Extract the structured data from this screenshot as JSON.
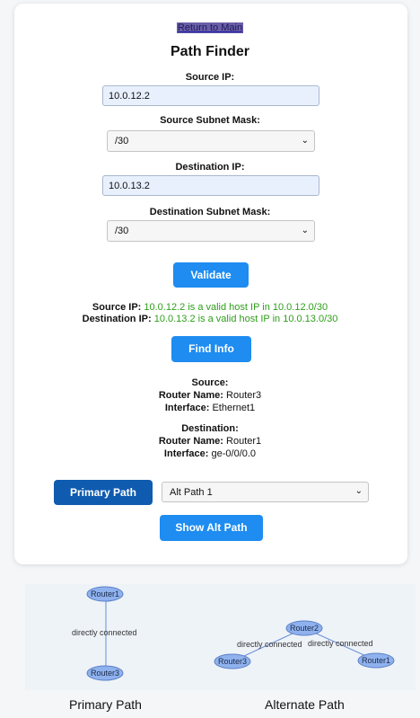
{
  "header": {
    "return_link": "Return to Main",
    "title": "Path Finder"
  },
  "form": {
    "source_ip_label": "Source IP:",
    "source_ip_value": "10.0.12.2",
    "source_mask_label": "Source Subnet Mask:",
    "source_mask_value": "/30",
    "dest_ip_label": "Destination IP:",
    "dest_ip_value": "10.0.13.2",
    "dest_mask_label": "Destination Subnet Mask:",
    "dest_mask_value": "/30",
    "validate_label": "Validate"
  },
  "validation": {
    "source_key": "Source IP:",
    "source_msg": "10.0.12.2 is a valid host IP in 10.0.12.0/30",
    "dest_key": "Destination IP:",
    "dest_msg": "10.0.13.2 is a valid host IP in 10.0.13.0/30",
    "ok_color": "#2e9e1a"
  },
  "find_info_label": "Find Info",
  "source_info": {
    "heading": "Source:",
    "router_key": "Router Name:",
    "router_val": "Router3",
    "iface_key": "Interface:",
    "iface_val": "Ethernet1"
  },
  "dest_info": {
    "heading": "Destination:",
    "router_key": "Router Name:",
    "router_val": "Router1",
    "iface_key": "Interface:",
    "iface_val": "ge-0/0/0.0"
  },
  "paths": {
    "primary_label": "Primary Path",
    "alt_select_value": "Alt Path 1",
    "show_alt_label": "Show Alt Path"
  },
  "graphs": {
    "primary": {
      "nodes": [
        "Router1",
        "Router3"
      ],
      "edge_label": "directly connected",
      "caption": "Primary Path"
    },
    "alternate": {
      "nodes": [
        "Router2",
        "Router3",
        "Router1"
      ],
      "edge_label_left": "directly connected",
      "edge_label_right": "directly connected",
      "caption": "Alternate Path"
    },
    "node_fill": "#8fb2ee",
    "node_stroke": "#5b7fc7"
  }
}
